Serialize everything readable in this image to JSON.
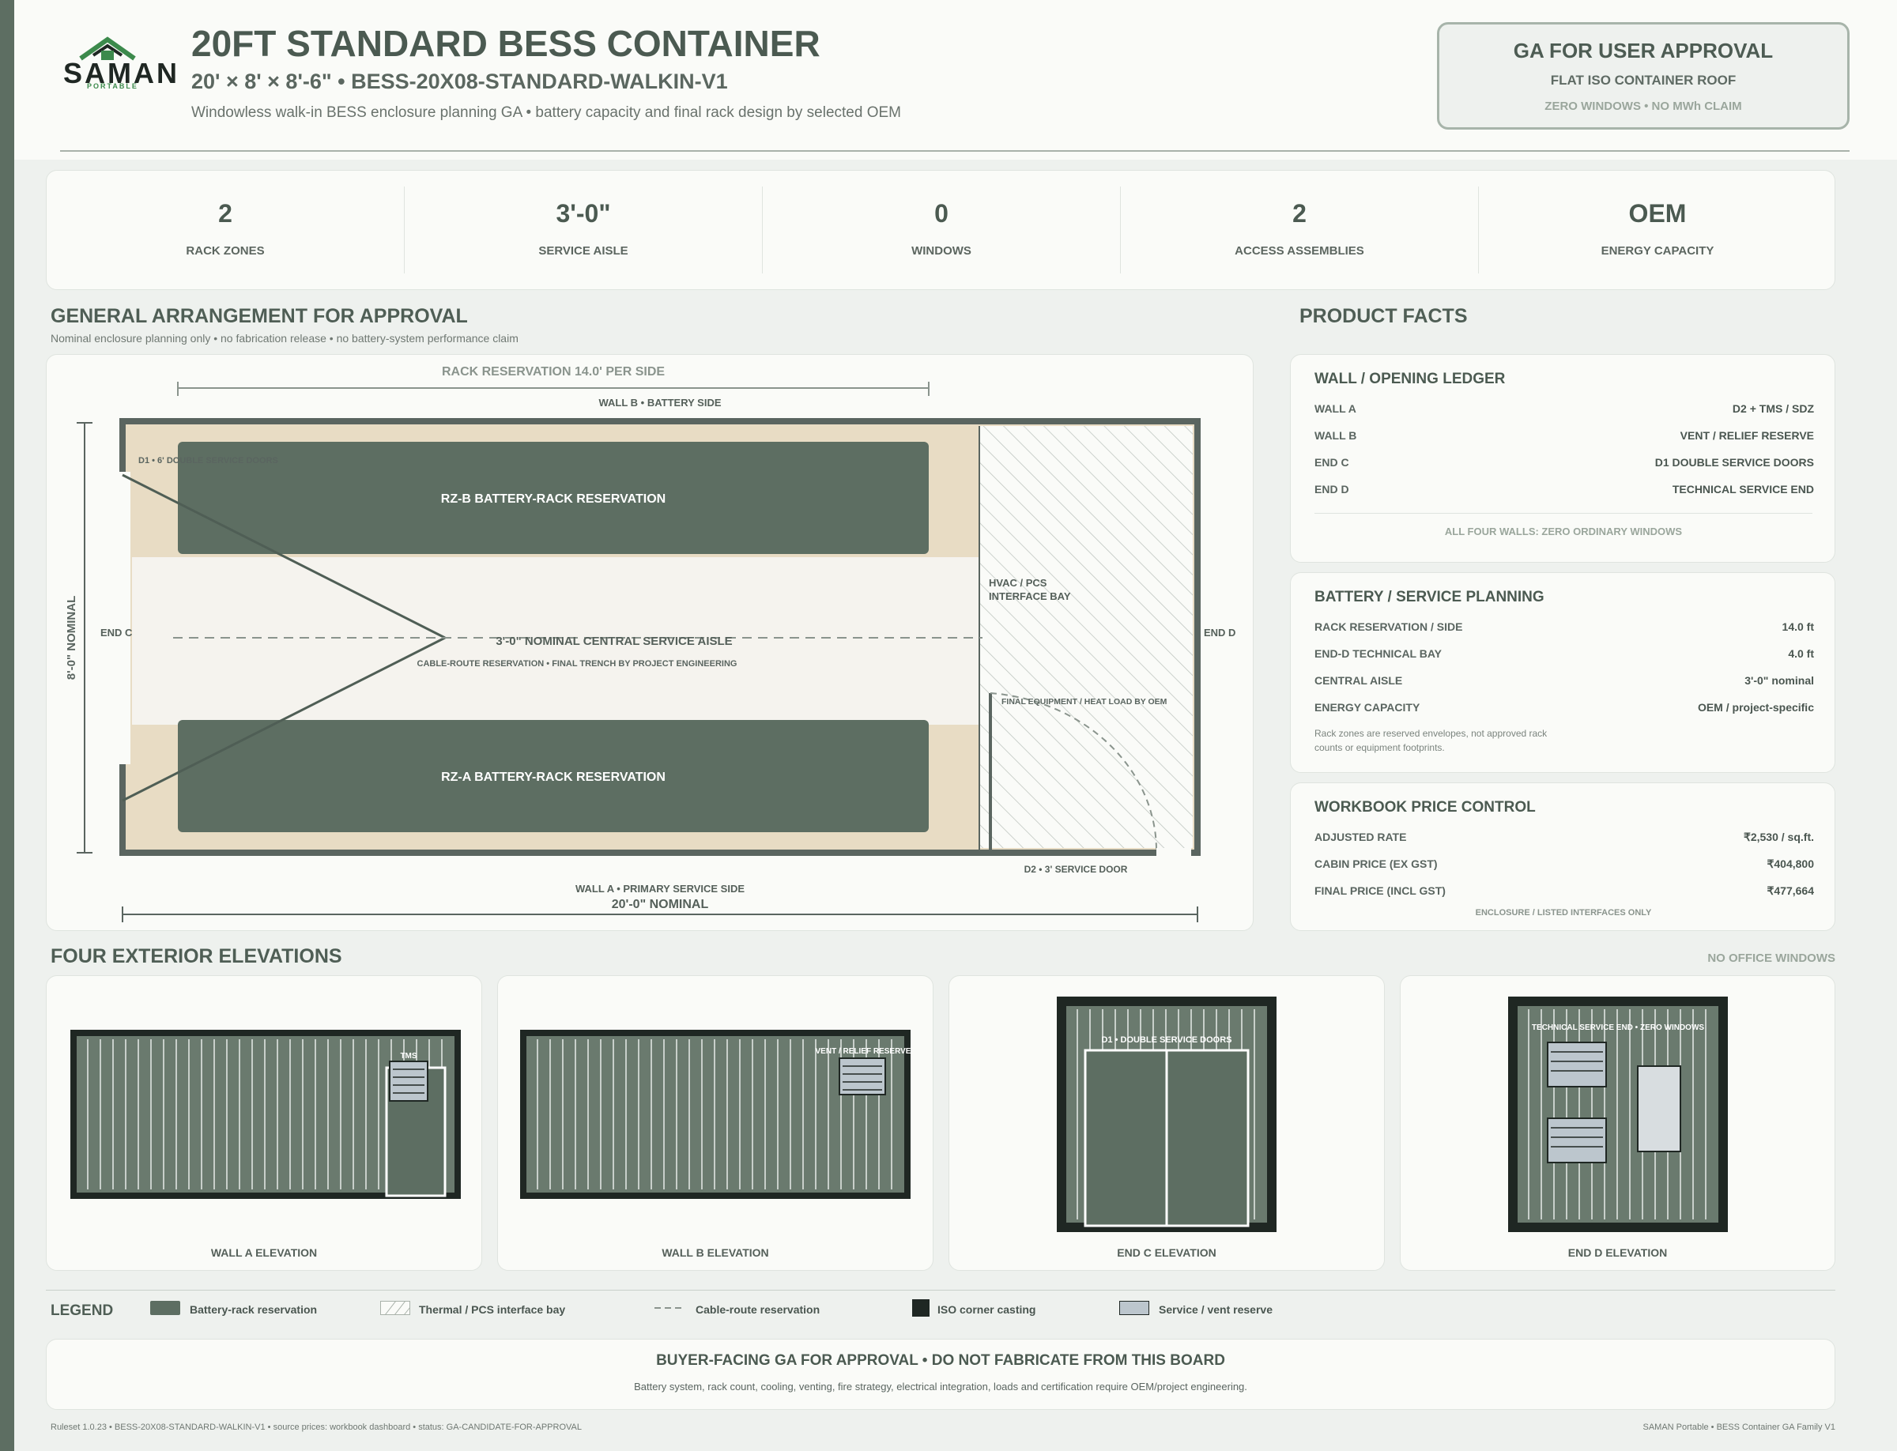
{
  "brand": {
    "name": "SAMAN",
    "tagline": "PORTABLE"
  },
  "header": {
    "title": "20FT STANDARD BESS CONTAINER",
    "subtitle": "20' × 8' × 8'-6\" • BESS-20X08-STANDARD-WALKIN-V1",
    "description": "Windowless walk-in BESS enclosure planning GA • battery capacity and final rack design by selected OEM"
  },
  "approval": {
    "title": "GA FOR USER APPROVAL",
    "line1": "FLAT ISO CONTAINER ROOF",
    "line2": "ZERO WINDOWS • NO MWh CLAIM"
  },
  "stats": [
    {
      "value": "2",
      "label": "RACK ZONES"
    },
    {
      "value": "3'-0\"",
      "label": "SERVICE AISLE"
    },
    {
      "value": "0",
      "label": "WINDOWS"
    },
    {
      "value": "2",
      "label": "ACCESS ASSEMBLIES"
    },
    {
      "value": "OEM",
      "label": "ENERGY CAPACITY"
    }
  ],
  "ga": {
    "title": "GENERAL ARRANGEMENT FOR APPROVAL",
    "subtitle": "Nominal enclosure planning only • no fabrication release • no battery-system performance claim",
    "rack_dim": "RACK RESERVATION 14.0' PER SIDE",
    "wall_b": "WALL B • BATTERY SIDE",
    "wall_a": "WALL A • PRIMARY SERVICE SIDE",
    "length": "20'-0\" NOMINAL",
    "width": "8'-0\" NOMINAL",
    "end_c": "END C",
    "end_d": "END D",
    "d1": "D1 • 6' DOUBLE SERVICE DOORS",
    "rz_b": "RZ-B BATTERY-RACK RESERVATION",
    "rz_a": "RZ-A BATTERY-RACK RESERVATION",
    "aisle": "3'-0\" NOMINAL CENTRAL SERVICE AISLE",
    "cable": "CABLE-ROUTE RESERVATION • FINAL TRENCH BY PROJECT ENGINEERING",
    "hvac_1": "HVAC / PCS",
    "hvac_2": "INTERFACE BAY",
    "final_eq": "FINAL EQUIPMENT / HEAT LOAD BY OEM",
    "d2": "D2 • 3' SERVICE DOOR"
  },
  "facts": {
    "title": "PRODUCT FACTS",
    "wall_ledger": {
      "title": "WALL / OPENING LEDGER",
      "rows": [
        {
          "label": "WALL A",
          "value": "D2 + TMS / SDZ"
        },
        {
          "label": "WALL B",
          "value": "VENT / RELIEF RESERVE"
        },
        {
          "label": "END C",
          "value": "D1 DOUBLE SERVICE DOORS"
        },
        {
          "label": "END D",
          "value": "TECHNICAL SERVICE END"
        }
      ],
      "note": "ALL FOUR WALLS: ZERO ORDINARY WINDOWS"
    },
    "battery": {
      "title": "BATTERY / SERVICE PLANNING",
      "rows": [
        {
          "label": "RACK RESERVATION / SIDE",
          "value": "14.0 ft"
        },
        {
          "label": "END-D TECHNICAL BAY",
          "value": "4.0 ft"
        },
        {
          "label": "CENTRAL AISLE",
          "value": "3'-0\" nominal"
        },
        {
          "label": "ENERGY CAPACITY",
          "value": "OEM / project-specific"
        }
      ],
      "note1": "Rack zones are reserved envelopes, not approved rack",
      "note2": "counts or equipment footprints."
    },
    "price": {
      "title": "WORKBOOK PRICE CONTROL",
      "rows": [
        {
          "label": "ADJUSTED RATE",
          "value": "₹2,530 / sq.ft."
        },
        {
          "label": "CABIN PRICE (EX GST)",
          "value": "₹404,800"
        },
        {
          "label": "FINAL PRICE (INCL GST)",
          "value": "₹477,664"
        }
      ],
      "note": "ENCLOSURE / LISTED INTERFACES ONLY"
    }
  },
  "elevations": {
    "title": "FOUR EXTERIOR ELEVATIONS",
    "tag": "NO OFFICE WINDOWS",
    "wall_a": "WALL A ELEVATION",
    "wall_b": "WALL B ELEVATION",
    "end_c": "END C ELEVATION",
    "end_d": "END D ELEVATION",
    "tms": "TMS",
    "vent": "VENT / RELIEF RESERVE",
    "d1": "D1 • DOUBLE SERVICE DOORS",
    "tech": "TECHNICAL SERVICE END • ZERO WINDOWS"
  },
  "legend": {
    "title": "LEGEND",
    "items": [
      "Battery-rack reservation",
      "Thermal / PCS interface bay",
      "Cable-route reservation",
      "ISO corner casting",
      "Service / vent reserve"
    ]
  },
  "disclaimer": {
    "title": "BUYER-FACING GA FOR APPROVAL • DO NOT FABRICATE FROM THIS BOARD",
    "text": "Battery system, rack count, cooling, venting, fire strategy, electrical integration, loads and certification require OEM/project engineering."
  },
  "footer": {
    "left": "Ruleset 1.0.23 • BESS-20X08-STANDARD-WALKIN-V1 • source prices: workbook dashboard • status: GA-CANDIDATE-FOR-APPROVAL",
    "right": "SAMAN Portable • BESS Container GA Family V1"
  },
  "colors": {
    "primary": "#5d6e62",
    "sand": "#e8dcc4",
    "accent_green": "#3c8a4c",
    "vent": "#bcc6cd"
  }
}
